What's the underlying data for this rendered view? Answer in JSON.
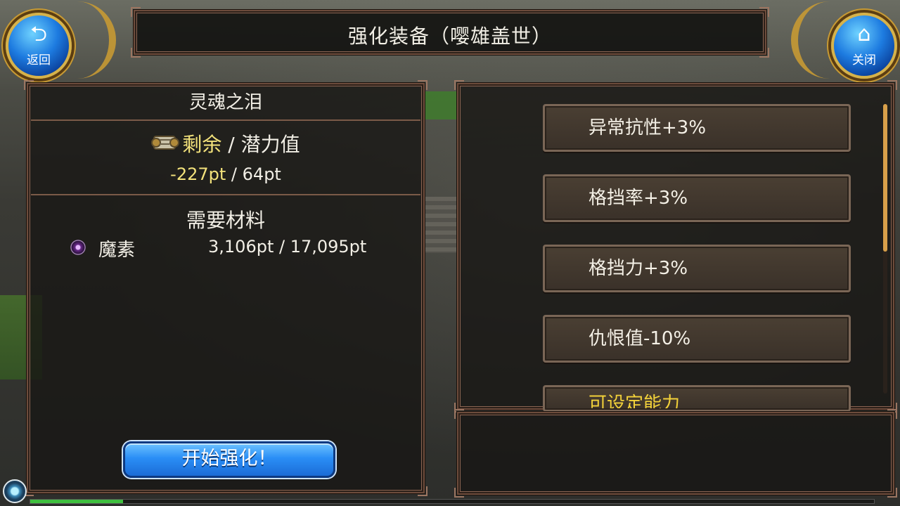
{
  "title": "强化装备（嘤雄盖世）",
  "nav": {
    "back_label": "返回",
    "close_label": "关闭"
  },
  "left": {
    "header": "灵魂之泪",
    "potential": {
      "remaining_label": "剩余",
      "separator": "/",
      "potential_label": "潜力值",
      "remaining_value": "-227pt",
      "sep2": "/",
      "potential_value": "64pt"
    },
    "materials_title": "需要材料",
    "materials": [
      {
        "name": "魔素",
        "value": "3,106pt / 17,095pt"
      }
    ],
    "start_button": "开始强化！"
  },
  "options": [
    {
      "label": "异常抗性+3%"
    },
    {
      "label": "格挡率+3%"
    },
    {
      "label": "格挡力+3%"
    },
    {
      "label": "仇恨值-10%"
    },
    {
      "label": "可设定能力"
    }
  ],
  "exp_fraction": 0.11,
  "colors": {
    "accent_yellow": "#f3e27b",
    "button_blue": "#2a8ef6"
  }
}
